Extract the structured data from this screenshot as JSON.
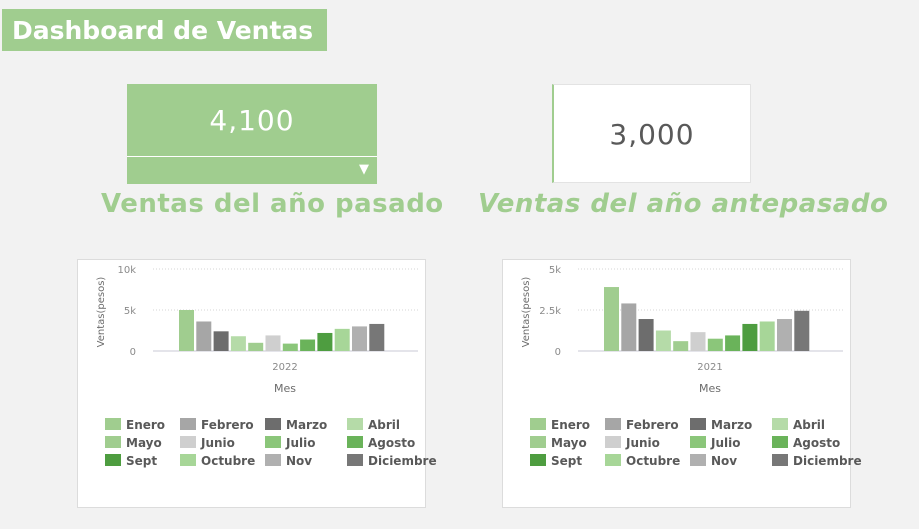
{
  "header": {
    "title": "Dashboard de Ventas"
  },
  "kpi_current": {
    "value": "4,100",
    "dropdown_icon": "triangle-down-icon",
    "caption": "Ventas del año pasado"
  },
  "kpi_previous": {
    "value": "3,000",
    "caption": "Ventas del año antepasado"
  },
  "colors": [
    "#a0cd8f",
    "#a6a6a6",
    "#6d6d6d",
    "#b5dba8",
    "#a0cd8f",
    "#cfcfcf",
    "#8bc67a",
    "#6ab35a",
    "#4e9d40",
    "#a7d698",
    "#b0b0b0",
    "#777777"
  ],
  "chart_data": [
    {
      "type": "bar",
      "x": [
        "2022"
      ],
      "xlabel": "Mes",
      "ylabel": "Ventas(pesos)",
      "ylim": [
        0,
        10000
      ],
      "yticks": [
        "0",
        "5k",
        "10k"
      ],
      "yticks_values": [
        0,
        5000,
        10000
      ],
      "grid": true,
      "legend_position": "bottom",
      "series": [
        {
          "name": "Enero",
          "values": [
            5000
          ]
        },
        {
          "name": "Febrero",
          "values": [
            3600
          ]
        },
        {
          "name": "Marzo",
          "values": [
            2400
          ]
        },
        {
          "name": "Abril",
          "values": [
            1800
          ]
        },
        {
          "name": "Mayo",
          "values": [
            1000
          ]
        },
        {
          "name": "Junio",
          "values": [
            1900
          ]
        },
        {
          "name": "Julio",
          "values": [
            900
          ]
        },
        {
          "name": "Agosto",
          "values": [
            1400
          ]
        },
        {
          "name": "Sept",
          "values": [
            2200
          ]
        },
        {
          "name": "Octubre",
          "values": [
            2700
          ]
        },
        {
          "name": "Nov",
          "values": [
            3000
          ]
        },
        {
          "name": "Diciembre",
          "values": [
            3300
          ]
        }
      ]
    },
    {
      "type": "bar",
      "x": [
        "2021"
      ],
      "xlabel": "Mes",
      "ylabel": "Ventas(pesos)",
      "ylim": [
        0,
        5000
      ],
      "yticks": [
        "0",
        "2.5k",
        "5k"
      ],
      "yticks_values": [
        0,
        2500,
        5000
      ],
      "grid": true,
      "legend_position": "bottom",
      "series": [
        {
          "name": "Enero",
          "values": [
            3900
          ]
        },
        {
          "name": "Febrero",
          "values": [
            2900
          ]
        },
        {
          "name": "Marzo",
          "values": [
            1950
          ]
        },
        {
          "name": "Abril",
          "values": [
            1250
          ]
        },
        {
          "name": "Mayo",
          "values": [
            600
          ]
        },
        {
          "name": "Junio",
          "values": [
            1150
          ]
        },
        {
          "name": "Julio",
          "values": [
            750
          ]
        },
        {
          "name": "Agosto",
          "values": [
            950
          ]
        },
        {
          "name": "Sept",
          "values": [
            1650
          ]
        },
        {
          "name": "Octubre",
          "values": [
            1800
          ]
        },
        {
          "name": "Nov",
          "values": [
            1950
          ]
        },
        {
          "name": "Diciembre",
          "values": [
            2450
          ]
        }
      ]
    }
  ]
}
